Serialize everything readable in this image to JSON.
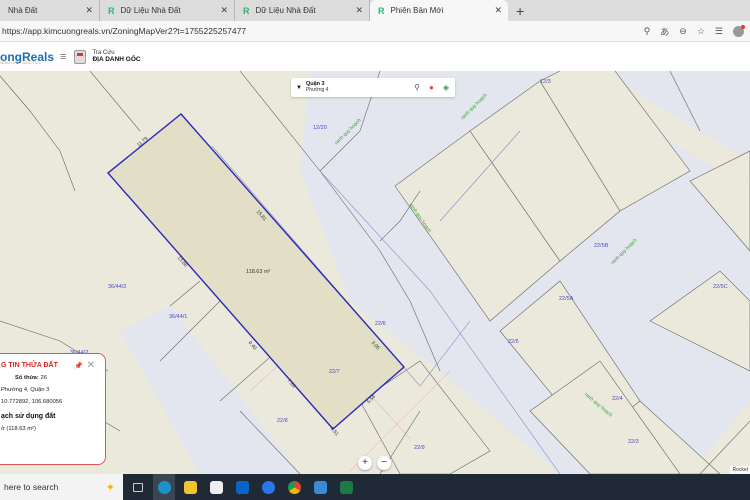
{
  "browser": {
    "tabs": [
      {
        "label": "Nhà Đất"
      },
      {
        "label": "Dữ Liệu Nhà Đất"
      },
      {
        "label": "Dữ Liệu Nhà Đất"
      },
      {
        "label": "Phiên Bản Mới",
        "active": true
      }
    ],
    "url": "https://app.kimcuongreals.vn/ZoningMapVer2?t=1755225257477"
  },
  "app": {
    "logo": "ongReals",
    "logo_tagline": "NĂNG LỰC · SÁNG TẠO",
    "lookup_small": "Tra Cứu",
    "lookup_title": "ĐỊA DANH GỐC"
  },
  "search": {
    "district": "Quận 3",
    "ward": "Phường 4"
  },
  "map": {
    "parcel_area": "118.63 m²",
    "edges": [
      "11.79",
      "15.81",
      "13.66",
      "7.26",
      "5.54",
      "0.40",
      "0.51",
      "3.05"
    ],
    "parcel_labels": [
      "12/20",
      "12/3",
      "36/44/2",
      "36/44/1",
      "36/44/2",
      "22/6",
      "22/7",
      "22/8",
      "22/9",
      "22/5",
      "22/5A",
      "22/5B",
      "22/5C",
      "22/4",
      "22/3"
    ],
    "planning_label": "ranh quy hoạch",
    "attribution": "Rocket"
  },
  "popup": {
    "title": "G TIN THỬA ĐẤT",
    "so_thua_label": "Số thửa:",
    "so_thua": "26",
    "address": "Phường 4, Quận 3",
    "coords": "10.772892, 106.680056",
    "section": "ạch sử dụng đất",
    "usage": "ở (118.63 m²)"
  },
  "zoom": {
    "in": "+",
    "out": "−"
  },
  "taskbar": {
    "search_placeholder": "here to search"
  },
  "colors": {
    "accent": "#1c6fb7",
    "parcel_border": "#2a2ab8",
    "popup_title": "#d22"
  }
}
